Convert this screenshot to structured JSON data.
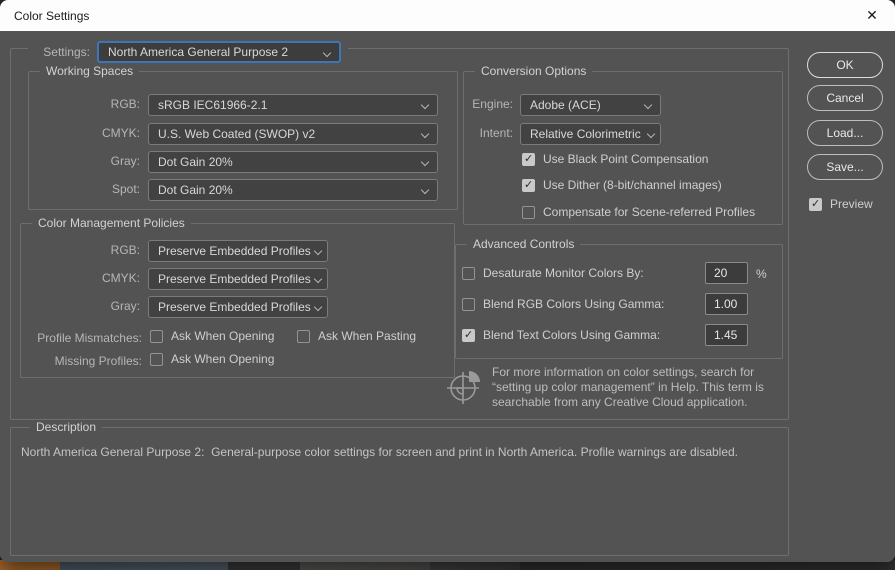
{
  "window": {
    "title": "Color Settings",
    "close_glyph": "✕"
  },
  "settings": {
    "label": "Settings:",
    "value": "North America General Purpose 2"
  },
  "working_spaces": {
    "title": "Working Spaces",
    "rows": [
      {
        "label": "RGB:",
        "value": "sRGB IEC61966-2.1"
      },
      {
        "label": "CMYK:",
        "value": "U.S. Web Coated (SWOP) v2"
      },
      {
        "label": "Gray:",
        "value": "Dot Gain 20%"
      },
      {
        "label": "Spot:",
        "value": "Dot Gain 20%"
      }
    ]
  },
  "color_management_policies": {
    "title": "Color Management Policies",
    "rows": [
      {
        "label": "RGB:",
        "value": "Preserve Embedded Profiles"
      },
      {
        "label": "CMYK:",
        "value": "Preserve Embedded Profiles"
      },
      {
        "label": "Gray:",
        "value": "Preserve Embedded Profiles"
      }
    ],
    "profile_mismatches": {
      "label": "Profile Mismatches:",
      "ask_opening": {
        "label": "Ask When Opening",
        "checked": false
      },
      "ask_pasting": {
        "label": "Ask When Pasting",
        "checked": false
      }
    },
    "missing_profiles": {
      "label": "Missing Profiles:",
      "ask_opening": {
        "label": "Ask When Opening",
        "checked": false
      }
    }
  },
  "conversion_options": {
    "title": "Conversion Options",
    "engine": {
      "label": "Engine:",
      "value": "Adobe (ACE)"
    },
    "intent": {
      "label": "Intent:",
      "value": "Relative Colorimetric"
    },
    "checkboxes": [
      {
        "label": "Use Black Point Compensation",
        "checked": true
      },
      {
        "label": "Use Dither (8-bit/channel images)",
        "checked": true
      },
      {
        "label": "Compensate for Scene-referred Profiles",
        "checked": false
      }
    ]
  },
  "advanced_controls": {
    "title": "Advanced Controls",
    "rows": [
      {
        "label": "Desaturate Monitor Colors By:",
        "checked": false,
        "value": "20",
        "suffix": "%"
      },
      {
        "label": "Blend RGB Colors Using Gamma:",
        "checked": false,
        "value": "1.00"
      },
      {
        "label": "Blend Text Colors Using Gamma:",
        "checked": true,
        "value": "1.45"
      }
    ]
  },
  "info": {
    "icon": "color-management-registration-icon",
    "text": "For more information on color settings, search for “setting up color management” in Help. This term is searchable from any Creative Cloud application."
  },
  "description": {
    "title": "Description",
    "text": "North America General Purpose 2:  General-purpose color settings for screen and print in North America. Profile warnings are disabled."
  },
  "buttons": {
    "ok": "OK",
    "cancel": "Cancel",
    "load": "Load...",
    "save": "Save...",
    "preview": {
      "label": "Preview",
      "checked": true
    }
  },
  "colors": {
    "dialog_bg": "#535353",
    "titlebar_bg": "#fdfdfd",
    "group_border": "#6e6e6e",
    "field_bg": "#424242",
    "focus_border": "#3d76b8",
    "checkbox_checked": "#c9c9c9"
  }
}
